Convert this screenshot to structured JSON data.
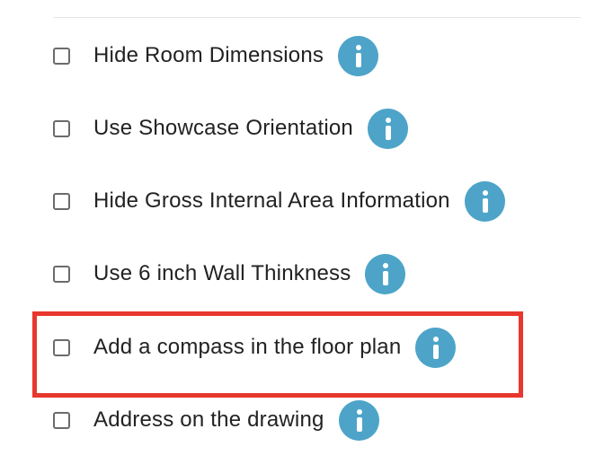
{
  "options": [
    {
      "label": "Hide Room Dimensions",
      "checked": false,
      "info_icon": "info-icon"
    },
    {
      "label": "Use Showcase Orientation",
      "checked": false,
      "info_icon": "info-icon"
    },
    {
      "label": "Hide Gross Internal Area Information",
      "checked": false,
      "info_icon": "info-icon"
    },
    {
      "label": "Use 6 inch Wall Thinkness",
      "checked": false,
      "info_icon": "info-icon"
    },
    {
      "label": "Add a compass in the floor plan",
      "checked": false,
      "info_icon": "info-icon",
      "highlighted": true
    },
    {
      "label": "Address on the drawing",
      "checked": false,
      "info_icon": "info-icon"
    }
  ],
  "colors": {
    "info_icon": "#4da4c8",
    "highlight": "#e8372c",
    "checkbox_border": "#6b6b6b",
    "text": "#222222"
  }
}
